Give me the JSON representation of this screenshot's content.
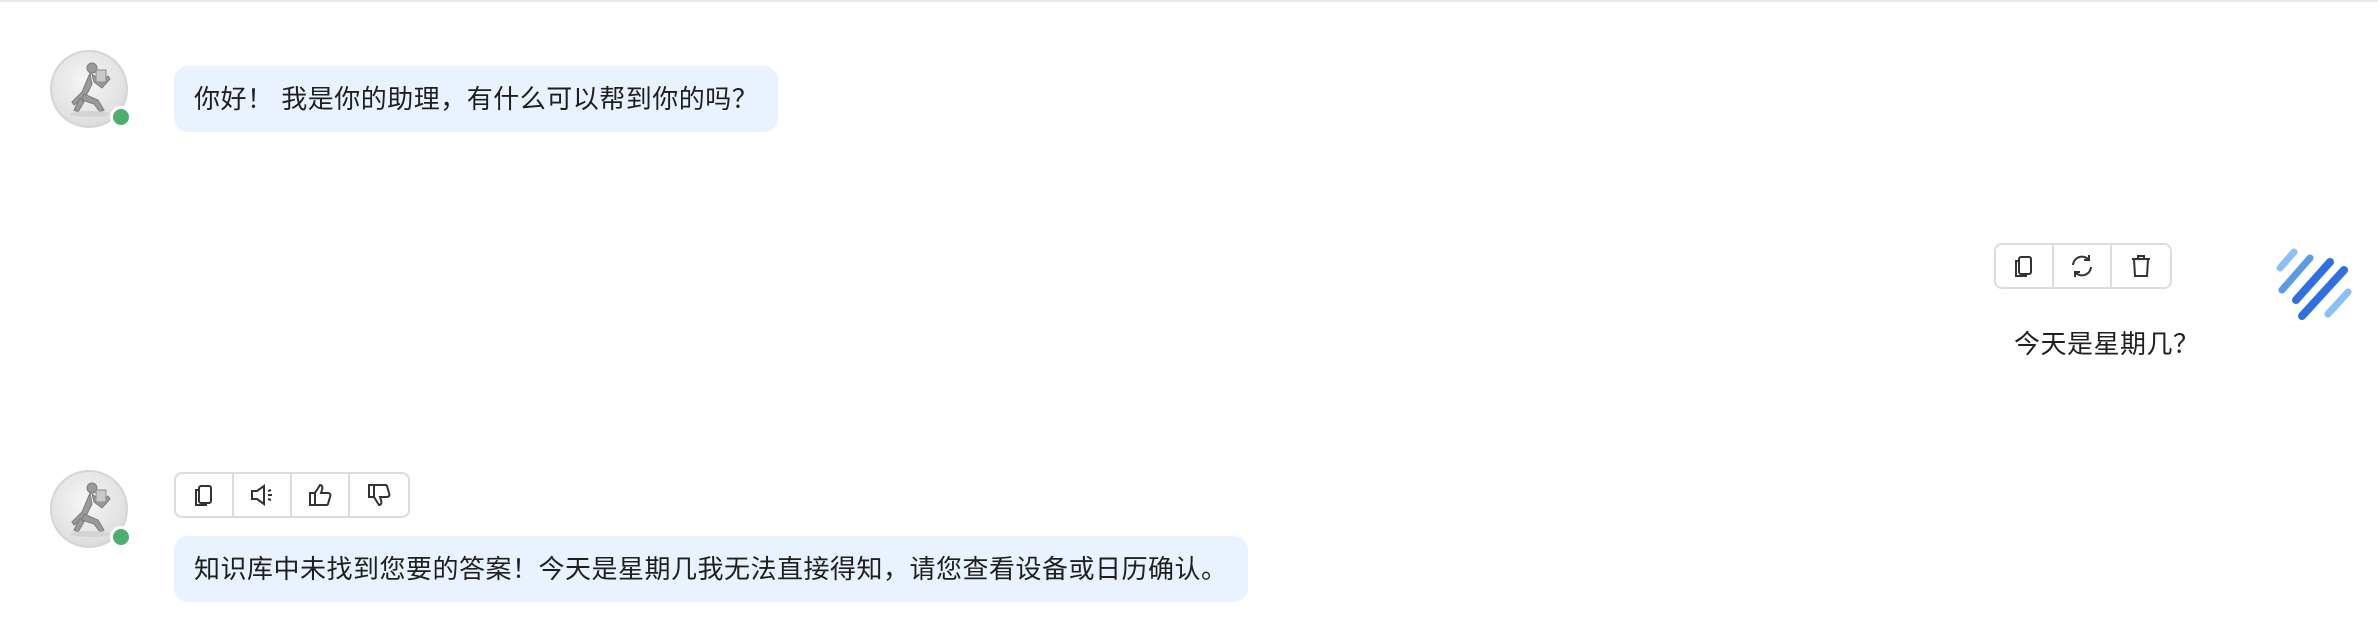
{
  "messages": [
    {
      "role": "assistant",
      "text": "你好！ 我是你的助理，有什么可以帮到你的吗？"
    },
    {
      "role": "user",
      "text": "今天是星期几？",
      "actions": [
        "copy-icon",
        "refresh-icon",
        "trash-icon"
      ]
    },
    {
      "role": "assistant",
      "text": "知识库中未找到您要的答案！今天是星期几我无法直接得知，请您查看设备或日历确认。",
      "actions": [
        "copy-icon",
        "speaker-icon",
        "thumbs-up-icon",
        "thumbs-down-icon"
      ]
    }
  ],
  "colors": {
    "bubble_bg": "#e8f3ff",
    "online_status": "#4caf6e",
    "user_logo_primary": "#2f6fe0",
    "user_logo_light": "#8cc0f5"
  }
}
